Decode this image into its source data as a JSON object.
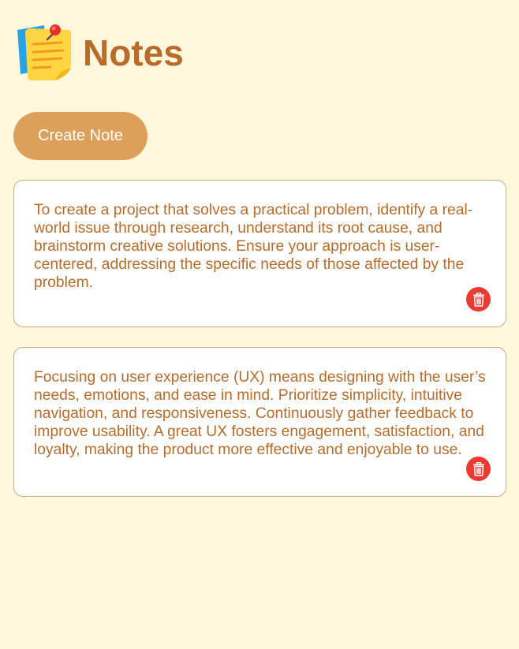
{
  "app": {
    "title": "Notes",
    "logo_icon": "sticky-note-icon"
  },
  "toolbar": {
    "create_label": "Create Note"
  },
  "notes": [
    {
      "text": "To create a project that solves a practical problem, identify a real-world issue through research, understand its root cause, and brainstorm creative solutions. Ensure your approach is user-centered, addressing the specific needs of those affected by the problem.",
      "delete_icon": "trash-icon"
    },
    {
      "text": "Focusing on user experience (UX) means designing with the user’s needs, emotions, and ease in mind. Prioritize simplicity, intuitive navigation, and responsiveness. Continuously gather feedback to improve usability. A great UX fosters engagement, satisfaction, and loyalty, making the product more effective and enjoyable to use.",
      "delete_icon": "trash-icon"
    }
  ],
  "colors": {
    "background": "#fff8dd",
    "accent": "#dda05a",
    "text": "#b86b2a",
    "delete": "#ec3a32",
    "card_border": "#d2a67d"
  }
}
